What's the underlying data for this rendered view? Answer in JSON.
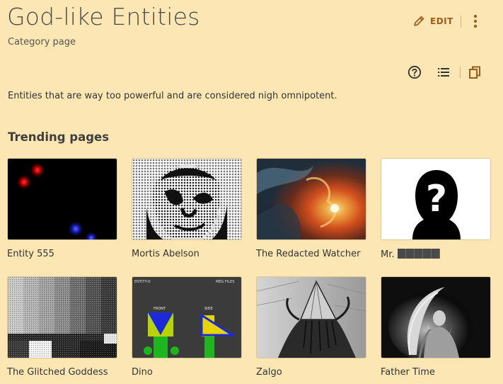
{
  "page": {
    "title": "God-like Entities",
    "subtitle": "Category page",
    "description": "Entities that are way too powerful and are considered nigh omnipotent."
  },
  "actions": {
    "edit_label": "EDIT",
    "icons": [
      "pencil-icon",
      "more-vertical-icon",
      "help-icon",
      "list-icon",
      "copy-icon"
    ]
  },
  "trending": {
    "heading": "Trending pages",
    "items": [
      {
        "label": "Entity 555",
        "image": "red-blue-orbs-on-black"
      },
      {
        "label": "Mortis Abelson",
        "image": "high-contrast-face-portrait"
      },
      {
        "label": "The Redacted Watcher",
        "image": "fiery-nebula"
      },
      {
        "label": "Mr. ",
        "image": "question-mark-silhouette",
        "redacted": true
      },
      {
        "label": "The Glitched Goddess",
        "image": "tv-static-test-bars"
      },
      {
        "label": "Dino",
        "image": "entity-d-reference-sheet",
        "thumb_text": {
          "top_left": "ENTITY-D",
          "top_right": "MEG FILES",
          "front": "FRONT",
          "side": "SIDE"
        }
      },
      {
        "label": "Zalgo",
        "image": "pyramid-head-monster-sketch"
      },
      {
        "label": "Father Time",
        "image": "robed-figure-with-scythe"
      }
    ]
  },
  "colors": {
    "background": "#fce7b4",
    "accent": "#a15a1a"
  }
}
